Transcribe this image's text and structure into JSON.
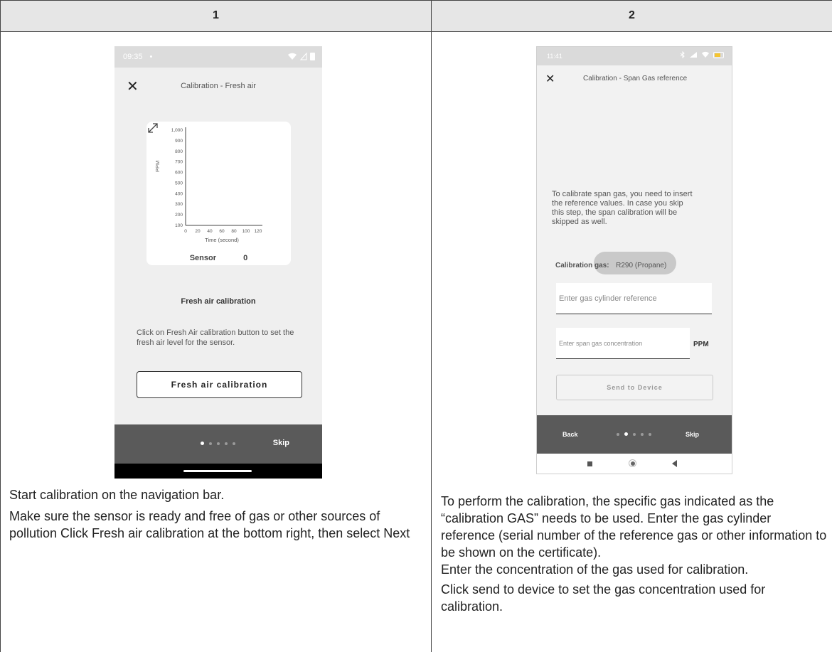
{
  "columns": [
    {
      "number": "1"
    },
    {
      "number": "2"
    }
  ],
  "phone1": {
    "status": {
      "time": "09:35",
      "dot": "•"
    },
    "title": "Calibration - Fresh air",
    "chart_data": {
      "type": "line",
      "xlabel": "Time (second)",
      "ylabel": "PPM",
      "x_ticks": [
        "0",
        "20",
        "40",
        "60",
        "80",
        "100",
        "120"
      ],
      "y_ticks": [
        "100",
        "200",
        "300",
        "400",
        "500",
        "600",
        "700",
        "800",
        "900",
        "1,000"
      ],
      "xlim": [
        0,
        120
      ],
      "ylim": [
        100,
        1000
      ],
      "series": [
        {
          "name": "Sensor",
          "value": "0",
          "values": []
        }
      ]
    },
    "heading": "Fresh air calibration",
    "description": "Click on Fresh Air calibration button to set the fresh air level for the sensor.",
    "button_label": "Fresh air calibration",
    "skip_label": "Skip",
    "page_dots": 5,
    "active_dot": 0
  },
  "phone2": {
    "status": {
      "time": "11:41"
    },
    "title": "Calibration - Span Gas reference",
    "intro": "To calibrate span gas, you need to insert the reference values. In case you skip this step, the span calibration will be skipped as well.",
    "gas_label": "Calibration gas:",
    "gas_value": "R290 (Propane)",
    "cylinder_placeholder": "Enter gas cylinder reference",
    "concentration_placeholder": "Enter span gas concentration",
    "unit": "PPM",
    "send_label": "Send to Device",
    "back_label": "Back",
    "skip_label": "Skip",
    "page_dots": 5,
    "active_dot": 1
  },
  "col1_text": [
    "Start calibration on the navigation bar.",
    "Make sure the sensor is ready and free of gas or other sources of pollution Click Fresh air calibration at the bottom right, then select Next"
  ],
  "col2_text": [
    "To perform the calibration, the specific gas indicated as the “calibration GAS” needs to be used. Enter the gas cylinder reference (serial number of the reference gas or other information to be shown on the certificate).\nEnter the concentration of the gas used for calibration.",
    "Click send to device to set the gas concentration used for calibration."
  ]
}
